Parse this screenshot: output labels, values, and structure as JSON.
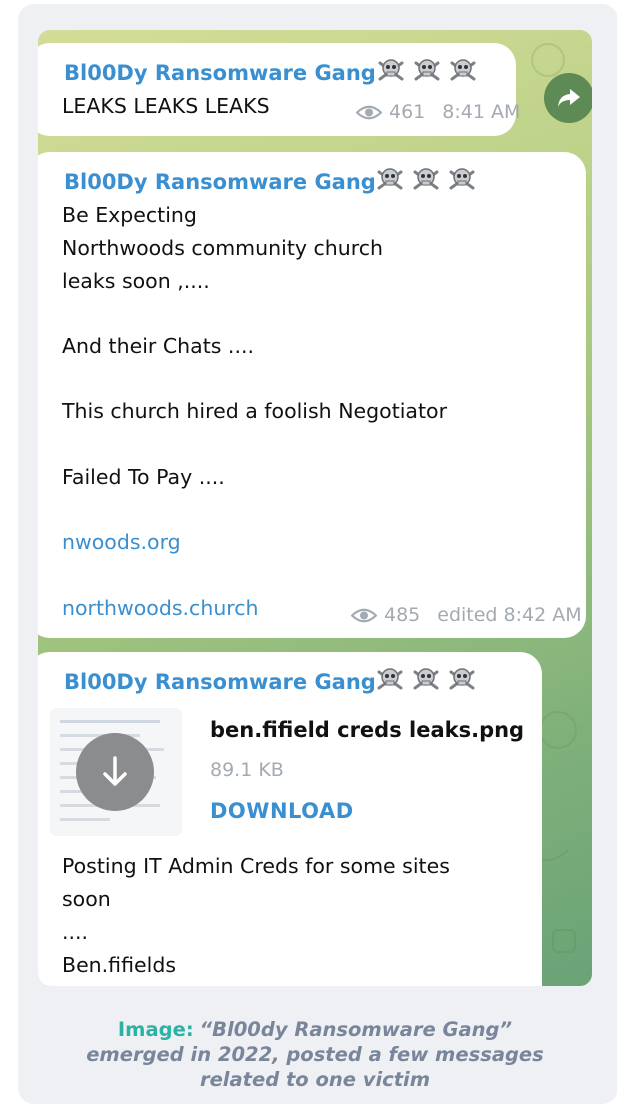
{
  "messages": [
    {
      "sender": "Bl00Dy Ransomware Gang",
      "text": "LEAKS LEAKS LEAKS",
      "views": "461",
      "time": "8:41 AM"
    },
    {
      "sender": "Bl00Dy Ransomware Gang",
      "lines": [
        "Be Expecting",
        "Northwoods community church",
        "leaks soon ,....",
        "",
        "And their Chats ....",
        "",
        "This church hired a foolish Negotiator",
        "",
        "Failed To Pay ....",
        ""
      ],
      "link1": "nwoods.org",
      "link2": "northwoods.church",
      "views": "485",
      "time": "edited 8:42 AM"
    },
    {
      "sender": "Bl00Dy Ransomware Gang",
      "file_name": "ben.fifield creds leaks.png",
      "file_size": "89.1 KB",
      "download_label": "DOWNLOAD",
      "lines": [
        "Posting IT Admin Creds for some sites",
        "soon",
        "....",
        "Ben.fifields"
      ]
    }
  ],
  "icons": {
    "skull": "skull-crossbones-icon",
    "views": "eye-icon",
    "forward": "forward-arrow-icon",
    "download": "download-arrow-icon"
  },
  "colors": {
    "sender": "#3a8fd0",
    "link": "#3a8fd0",
    "meta": "#a4aab2",
    "caption_label": "#2ab3a4",
    "caption_text": "#79859a"
  },
  "caption": {
    "label": "Image:",
    "line1": "“Bl00dy Ransomware Gang”",
    "line2": "emerged in 2022, posted a few messages",
    "line3": "related to one victim"
  }
}
